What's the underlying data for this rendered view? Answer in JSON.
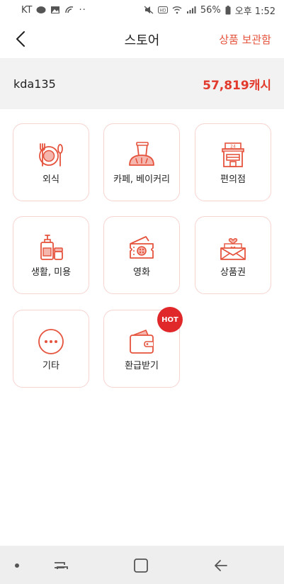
{
  "status_bar": {
    "carrier": "KT",
    "battery": "56%",
    "time": "오후 1:52"
  },
  "header": {
    "title": "스토어",
    "storage_link": "상품 보관함"
  },
  "account": {
    "user_id": "kda135",
    "cash": "57,819캐시"
  },
  "categories": [
    {
      "label": "외식",
      "icon": "dining-icon"
    },
    {
      "label": "카페, 베이커리",
      "icon": "cafe-bakery-icon"
    },
    {
      "label": "편의점",
      "icon": "convenience-store-icon"
    },
    {
      "label": "생활, 미용",
      "icon": "lifestyle-beauty-icon"
    },
    {
      "label": "영화",
      "icon": "movie-ticket-icon"
    },
    {
      "label": "상품권",
      "icon": "gift-card-icon"
    },
    {
      "label": "기타",
      "icon": "more-icon"
    },
    {
      "label": "환급받기",
      "icon": "wallet-icon",
      "badge": "HOT"
    }
  ],
  "colors": {
    "accent": "#e5533d",
    "cash": "#e23b2e",
    "tile_border": "#f7d4d0",
    "badge": "#e0282a"
  }
}
